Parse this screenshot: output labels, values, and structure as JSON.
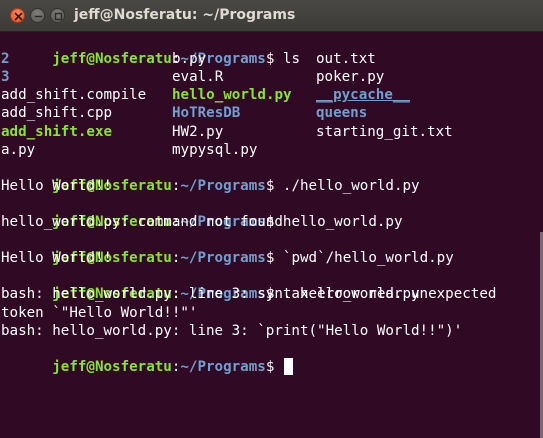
{
  "window": {
    "title": "jeff@Nosferatu: ~/Programs"
  },
  "prompt": {
    "user_host": "jeff@Nosferatu",
    "colon": ":",
    "path": "~/Programs",
    "dollar": "$ "
  },
  "colors": {
    "background": "#300a24",
    "prompt_user": "#8ae234",
    "prompt_path": "#729fcf",
    "executable": "#8ae234",
    "directory": "#729fcf",
    "text": "#ffffff"
  },
  "session": {
    "cmd_ls": "ls",
    "listing": [
      {
        "c1": "2",
        "c1_type": "dir",
        "c2": "b.py",
        "c2_type": "file",
        "c3": "out.txt",
        "c3_type": "file"
      },
      {
        "c1": "3",
        "c1_type": "dir",
        "c2": "eval.R",
        "c2_type": "file",
        "c3": "poker.py",
        "c3_type": "file"
      },
      {
        "c1": "add_shift.compile",
        "c1_type": "file",
        "c2": "hello_world.py",
        "c2_type": "exec",
        "c3": "__pycache__",
        "c3_type": "dir-underline"
      },
      {
        "c1": "add_shift.cpp",
        "c1_type": "file",
        "c2": "HoTResDB",
        "c2_type": "dir",
        "c3": "queens",
        "c3_type": "dir"
      },
      {
        "c1": "add_shift.exe",
        "c1_type": "exec",
        "c2": "HW2.py",
        "c2_type": "file",
        "c3": "starting_git.txt",
        "c3_type": "file"
      },
      {
        "c1": "a.py",
        "c1_type": "file",
        "c2": "mypysql.py",
        "c2_type": "file",
        "c3": "",
        "c3_type": "file"
      }
    ],
    "cmd2": "./hello_world.py",
    "out2": "Hello World!!",
    "cmd3": "hello_world.py",
    "out3": "hello_world.py: command not found",
    "cmd4": "`pwd`/hello_world.py",
    "out4": "Hello World!!",
    "cmd5": ". hello_world.py",
    "out5a": "bash: hello_world.py: line 3: syntax error near unexpected",
    "out5b": "token `\"Hello World!!\"'",
    "out5c": "bash: hello_world.py: line 3: `print(\"Hello World!!\")'"
  }
}
